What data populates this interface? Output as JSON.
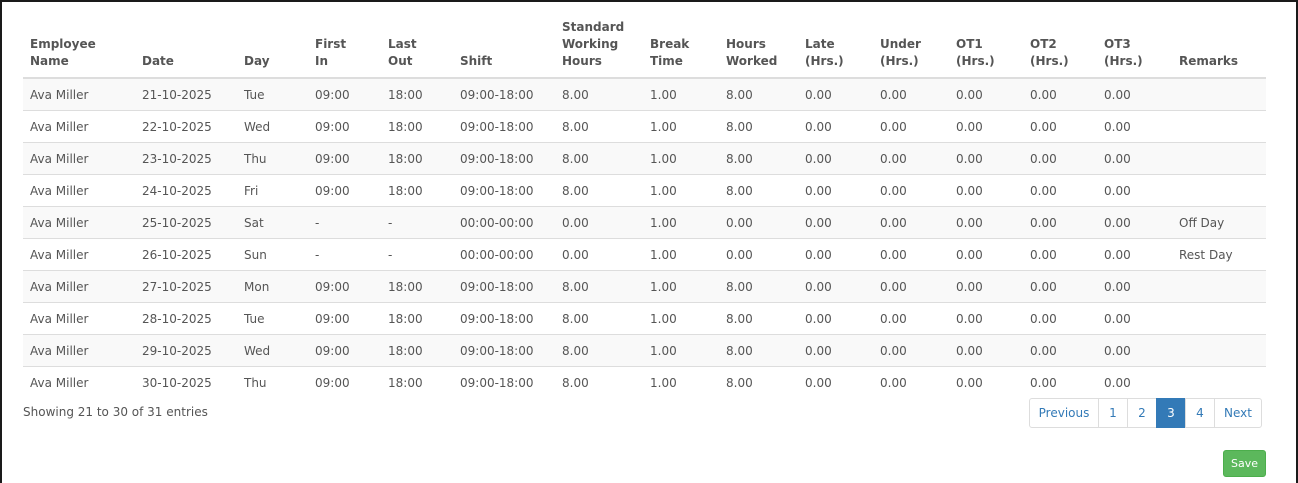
{
  "table": {
    "columns": [
      [
        "Employee",
        "Name"
      ],
      [
        "Date"
      ],
      [
        "Day"
      ],
      [
        "First",
        "In"
      ],
      [
        "Last",
        "Out"
      ],
      [
        "Shift"
      ],
      [
        "Standard",
        "Working",
        "Hours"
      ],
      [
        "Break",
        "Time"
      ],
      [
        "Hours",
        "Worked"
      ],
      [
        "Late",
        "(Hrs.)"
      ],
      [
        "Under",
        "(Hrs.)"
      ],
      [
        "OT1",
        "(Hrs.)"
      ],
      [
        "OT2",
        "(Hrs.)"
      ],
      [
        "OT3",
        "(Hrs.)"
      ],
      [
        "Remarks"
      ]
    ],
    "rows": [
      [
        "Ava Miller",
        "21-10-2025",
        "Tue",
        "09:00",
        "18:00",
        "09:00-18:00",
        "8.00",
        "1.00",
        "8.00",
        "0.00",
        "0.00",
        "0.00",
        "0.00",
        "0.00",
        ""
      ],
      [
        "Ava Miller",
        "22-10-2025",
        "Wed",
        "09:00",
        "18:00",
        "09:00-18:00",
        "8.00",
        "1.00",
        "8.00",
        "0.00",
        "0.00",
        "0.00",
        "0.00",
        "0.00",
        ""
      ],
      [
        "Ava Miller",
        "23-10-2025",
        "Thu",
        "09:00",
        "18:00",
        "09:00-18:00",
        "8.00",
        "1.00",
        "8.00",
        "0.00",
        "0.00",
        "0.00",
        "0.00",
        "0.00",
        ""
      ],
      [
        "Ava Miller",
        "24-10-2025",
        "Fri",
        "09:00",
        "18:00",
        "09:00-18:00",
        "8.00",
        "1.00",
        "8.00",
        "0.00",
        "0.00",
        "0.00",
        "0.00",
        "0.00",
        ""
      ],
      [
        "Ava Miller",
        "25-10-2025",
        "Sat",
        "-",
        "-",
        "00:00-00:00",
        "0.00",
        "1.00",
        "0.00",
        "0.00",
        "0.00",
        "0.00",
        "0.00",
        "0.00",
        "Off Day"
      ],
      [
        "Ava Miller",
        "26-10-2025",
        "Sun",
        "-",
        "-",
        "00:00-00:00",
        "0.00",
        "1.00",
        "0.00",
        "0.00",
        "0.00",
        "0.00",
        "0.00",
        "0.00",
        "Rest Day"
      ],
      [
        "Ava Miller",
        "27-10-2025",
        "Mon",
        "09:00",
        "18:00",
        "09:00-18:00",
        "8.00",
        "1.00",
        "8.00",
        "0.00",
        "0.00",
        "0.00",
        "0.00",
        "0.00",
        ""
      ],
      [
        "Ava Miller",
        "28-10-2025",
        "Tue",
        "09:00",
        "18:00",
        "09:00-18:00",
        "8.00",
        "1.00",
        "8.00",
        "0.00",
        "0.00",
        "0.00",
        "0.00",
        "0.00",
        ""
      ],
      [
        "Ava Miller",
        "29-10-2025",
        "Wed",
        "09:00",
        "18:00",
        "09:00-18:00",
        "8.00",
        "1.00",
        "8.00",
        "0.00",
        "0.00",
        "0.00",
        "0.00",
        "0.00",
        ""
      ],
      [
        "Ava Miller",
        "30-10-2025",
        "Thu",
        "09:00",
        "18:00",
        "09:00-18:00",
        "8.00",
        "1.00",
        "8.00",
        "0.00",
        "0.00",
        "0.00",
        "0.00",
        "0.00",
        ""
      ]
    ]
  },
  "info": "Showing 21 to 30 of 31 entries",
  "pagination": {
    "previous_label": "Previous",
    "pages": [
      "1",
      "2",
      "3",
      "4"
    ],
    "active_page": "3",
    "next_label": "Next"
  },
  "save_label": "Save",
  "colors": {
    "accent": "#337ab7",
    "save_button": "#5cb85c",
    "text": "#555555",
    "row_stripe": "#f9f9f9"
  }
}
